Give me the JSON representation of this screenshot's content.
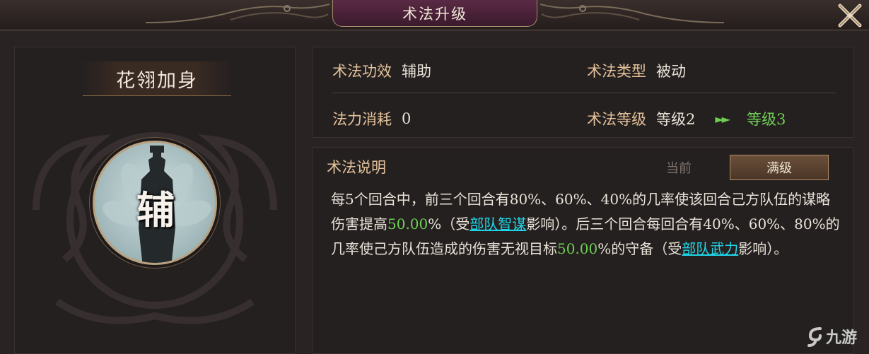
{
  "header": {
    "title": "术法升级"
  },
  "skill": {
    "name": "花翎加身",
    "icon_char": "辅"
  },
  "info": {
    "effect_label": "术法功效",
    "effect_value": "辅助",
    "type_label": "术法类型",
    "type_value": "被动",
    "cost_label": "法力消耗",
    "cost_value": "0",
    "level_label": "术法等级",
    "level_current": "等级2",
    "level_next": "等级3",
    "arrow": "►►"
  },
  "description": {
    "title": "术法说明",
    "tab_current": "当前",
    "tab_max": "满级",
    "t1": "每5个回合中，前三个回合有80%、60%、40%的几率使该回合己方队伍的谋略伤害提高",
    "v1": "50.00",
    "t2": "%（受",
    "link1": "部队智谋",
    "t3": "影响）。后三个回合每回合有40%、60%、80%的几率使己方队伍造成的伤害无视目标",
    "v2": "50.00",
    "t4": "%的守备（受",
    "link2": "部队武力",
    "t5": "影响）。"
  },
  "watermark": {
    "text": "九游"
  },
  "colors": {
    "accent": "#e3c29a",
    "highlight": "#6fcf55",
    "link": "#1fd6e8",
    "title_plate": "#4a2238"
  }
}
